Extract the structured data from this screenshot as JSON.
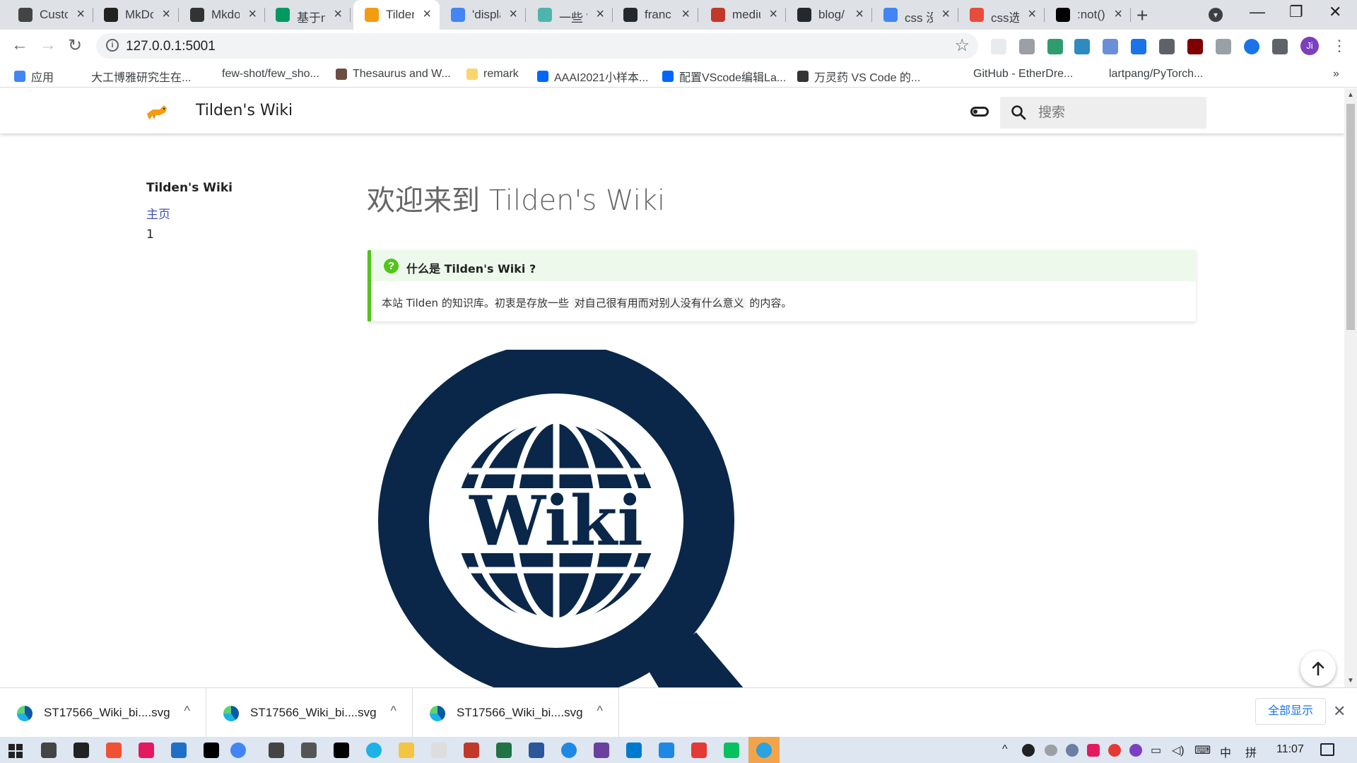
{
  "browser": {
    "tabs": [
      {
        "title": "Custo",
        "favicon_color": "#444444",
        "active": false
      },
      {
        "title": "MkDo",
        "favicon_color": "#222222",
        "active": false
      },
      {
        "title": "Mkdo",
        "favicon_color": "#333333",
        "active": false
      },
      {
        "title": "基于m",
        "favicon_color": "#009a61",
        "active": false
      },
      {
        "title": "Tilden",
        "favicon_color": "#f39c12",
        "active": true
      },
      {
        "title": "'displa",
        "favicon_color": "#4285f4",
        "active": false
      },
      {
        "title": "一些 V",
        "favicon_color": "#4db6ac",
        "active": false
      },
      {
        "title": "franc",
        "favicon_color": "#24292e",
        "active": false
      },
      {
        "title": "mediu",
        "favicon_color": "#c0392b",
        "active": false
      },
      {
        "title": "blog/",
        "favicon_color": "#24292e",
        "active": false
      },
      {
        "title": "css 没",
        "favicon_color": "#4285f4",
        "active": false
      },
      {
        "title": "css选",
        "favicon_color": "#e74c3c",
        "active": false
      },
      {
        "title": ":not()",
        "favicon_color": "#000000",
        "active": false
      }
    ],
    "url": "127.0.0.1:5001",
    "profile_initial": "Ji",
    "bookmarks": [
      {
        "label": "应用",
        "icon_color": "#4285f4"
      },
      {
        "label": "大工博雅研究生在...",
        "icon_color": "#ffffff"
      },
      {
        "label": "few-shot/few_sho...",
        "icon_color": "#ffffff"
      },
      {
        "label": "Thesaurus and W...",
        "icon_color": "#6d4c41"
      },
      {
        "label": "remark",
        "icon_color": "#f9d56e"
      },
      {
        "label": "AAAI2021小样本...",
        "icon_color": "#0066ff"
      },
      {
        "label": "配置VScode编辑La...",
        "icon_color": "#0066ff"
      },
      {
        "label": "万灵药 VS Code 的...",
        "icon_color": "#333333"
      },
      {
        "label": "GitHub - EtherDre...",
        "icon_color": "#ffffff"
      },
      {
        "label": "lartpang/PyTorch...",
        "icon_color": "#ffffff"
      }
    ]
  },
  "site": {
    "name": "Tilden's Wiki",
    "search_placeholder": "搜索",
    "nav": {
      "title": "Tilden's Wiki",
      "items": [
        "主页",
        "1"
      ]
    },
    "page": {
      "title": "欢迎来到 Tilden's Wiki",
      "admonition": {
        "title": "什么是 Tilden's Wiki ?",
        "body_before": "本站 Tilden 的知识库。初衷是存放一些 ",
        "body_code": "对自己很有用而对别人没有什么意义",
        "body_after": " 的内容。"
      },
      "logo_text": "Wiki",
      "logo_color": "#0a2749"
    }
  },
  "downloads": {
    "items": [
      "ST17566_Wiki_bi....svg",
      "ST17566_Wiki_bi....svg",
      "ST17566_Wiki_bi....svg"
    ],
    "show_all": "全部显示"
  },
  "taskbar": {
    "time": "11:07",
    "ime_lang": "中",
    "ime_mode": "拼"
  },
  "colors": {
    "accent_green": "#52c41a",
    "link_blue": "#3f51b5"
  }
}
